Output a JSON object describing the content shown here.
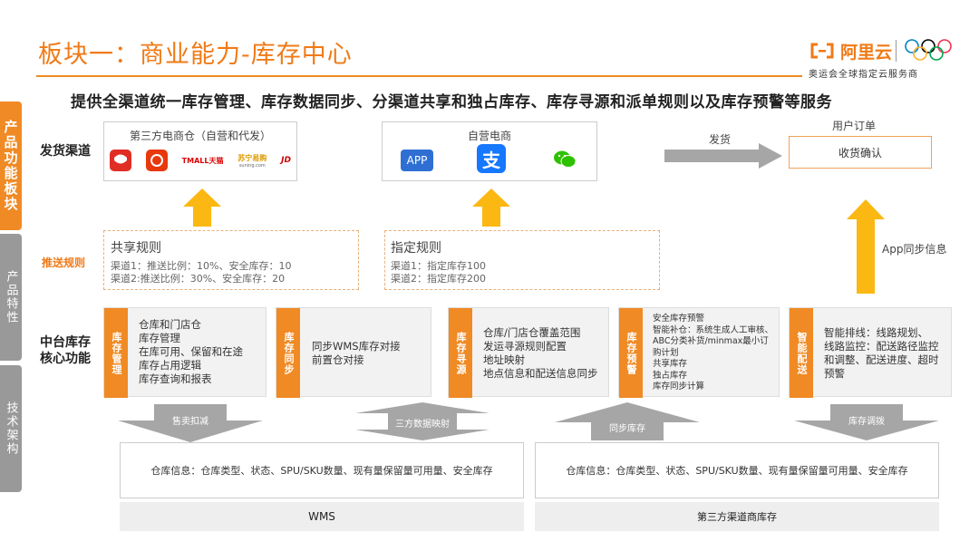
{
  "header": {
    "title": "板块一：商业能力-库存中心",
    "brand": "阿里云",
    "sponsor": "奥运会全球指定云服务商"
  },
  "sidetabs": [
    "产品功能板块",
    "产品特性",
    "技术架构"
  ],
  "subtitle": "提供全渠道统一库存管理、库存数据同步、分渠道共享和独占库存、库存寻源和派单规则以及库存预警等服务",
  "channels": {
    "label": "发货渠道",
    "third_party": {
      "title": "第三方电商仓（自营和代发）",
      "logos": [
        "TMALL天猫",
        "苏宁易购",
        "JD"
      ],
      "logo_subtexts": [
        "suning.com"
      ]
    },
    "self": {
      "title": "自营电商",
      "app_label": "APP",
      "alipay_glyph": "支",
      "wechat_label": ""
    },
    "ship_label": "发货",
    "user_order": {
      "title": "用户订单",
      "confirm": "收货确认"
    }
  },
  "push_rules": {
    "label": "推送规则",
    "shared": {
      "title": "共享规则",
      "lines": [
        "渠道1：推送比例：10%、安全库存：10",
        "渠道2:推送比例：30%、安全库存：20"
      ]
    },
    "assigned": {
      "title": "指定规则",
      "lines": [
        "渠道1：指定库存100",
        "渠道2：指定库存200"
      ]
    },
    "app_sync": "App同步信息"
  },
  "core": {
    "label_line1": "中台库存",
    "label_line2": "核心功能",
    "cards": [
      {
        "badge": "库存管理",
        "lines": [
          "仓库和门店仓",
          "库存管理",
          "在库可用、保留和在途",
          "库存占用逻辑",
          "库存查询和报表"
        ]
      },
      {
        "badge": "库存同步",
        "lines": [
          "同步WMS库存对接",
          "前置仓对接"
        ]
      },
      {
        "badge": "库存寻源",
        "lines": [
          "仓库/门店仓覆盖范围",
          "发运寻源规则配置",
          "地址映射",
          "地点信息和配送信息同步"
        ]
      },
      {
        "badge": "库存预警",
        "lines": [
          "安全库存预警",
          "智能补仓：系统生成人工审核、",
          "ABC分类补货/minmax最小订",
          "购计划",
          "共享库存",
          "独占库存",
          "库存同步计算"
        ]
      },
      {
        "badge": "智能配送",
        "lines": [
          "智能排线：线路规划、",
          "线路监控：配送路径监控",
          "和调整、配送进度、超时",
          "预警"
        ]
      }
    ]
  },
  "flows": [
    "售卖扣减",
    "三方数据映射",
    "同步库存",
    "库存调拨"
  ],
  "bottom": {
    "left_info": "仓库信息：仓库类型、状态、SPU/SKU数量、现有量保留量可用量、安全库存",
    "right_info": "仓库信息：仓库类型、状态、SPU/SKU数量、现有量保留量可用量、安全库存",
    "left_name": "WMS",
    "right_name": "第三方渠道商库存"
  },
  "colors": {
    "accent": "#f08a24",
    "arrow_yellow": "#fbb812",
    "arrow_grey": "#a6a6a6"
  }
}
